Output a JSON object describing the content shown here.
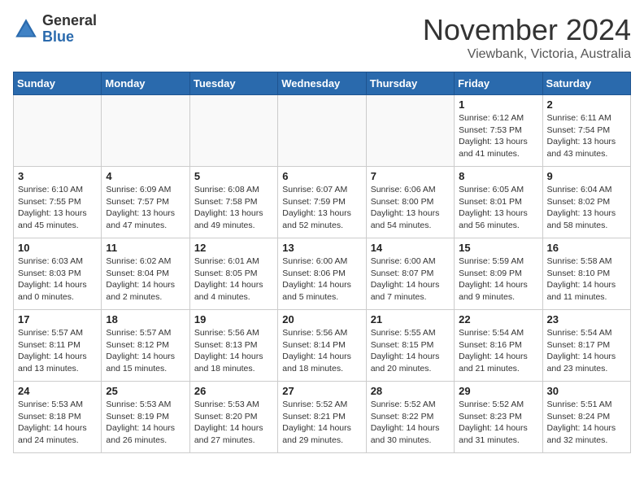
{
  "header": {
    "logo_general": "General",
    "logo_blue": "Blue",
    "month_year": "November 2024",
    "location": "Viewbank, Victoria, Australia"
  },
  "weekdays": [
    "Sunday",
    "Monday",
    "Tuesday",
    "Wednesday",
    "Thursday",
    "Friday",
    "Saturday"
  ],
  "weeks": [
    [
      {
        "day": "",
        "text": ""
      },
      {
        "day": "",
        "text": ""
      },
      {
        "day": "",
        "text": ""
      },
      {
        "day": "",
        "text": ""
      },
      {
        "day": "",
        "text": ""
      },
      {
        "day": "1",
        "text": "Sunrise: 6:12 AM\nSunset: 7:53 PM\nDaylight: 13 hours\nand 41 minutes."
      },
      {
        "day": "2",
        "text": "Sunrise: 6:11 AM\nSunset: 7:54 PM\nDaylight: 13 hours\nand 43 minutes."
      }
    ],
    [
      {
        "day": "3",
        "text": "Sunrise: 6:10 AM\nSunset: 7:55 PM\nDaylight: 13 hours\nand 45 minutes."
      },
      {
        "day": "4",
        "text": "Sunrise: 6:09 AM\nSunset: 7:57 PM\nDaylight: 13 hours\nand 47 minutes."
      },
      {
        "day": "5",
        "text": "Sunrise: 6:08 AM\nSunset: 7:58 PM\nDaylight: 13 hours\nand 49 minutes."
      },
      {
        "day": "6",
        "text": "Sunrise: 6:07 AM\nSunset: 7:59 PM\nDaylight: 13 hours\nand 52 minutes."
      },
      {
        "day": "7",
        "text": "Sunrise: 6:06 AM\nSunset: 8:00 PM\nDaylight: 13 hours\nand 54 minutes."
      },
      {
        "day": "8",
        "text": "Sunrise: 6:05 AM\nSunset: 8:01 PM\nDaylight: 13 hours\nand 56 minutes."
      },
      {
        "day": "9",
        "text": "Sunrise: 6:04 AM\nSunset: 8:02 PM\nDaylight: 13 hours\nand 58 minutes."
      }
    ],
    [
      {
        "day": "10",
        "text": "Sunrise: 6:03 AM\nSunset: 8:03 PM\nDaylight: 14 hours\nand 0 minutes."
      },
      {
        "day": "11",
        "text": "Sunrise: 6:02 AM\nSunset: 8:04 PM\nDaylight: 14 hours\nand 2 minutes."
      },
      {
        "day": "12",
        "text": "Sunrise: 6:01 AM\nSunset: 8:05 PM\nDaylight: 14 hours\nand 4 minutes."
      },
      {
        "day": "13",
        "text": "Sunrise: 6:00 AM\nSunset: 8:06 PM\nDaylight: 14 hours\nand 5 minutes."
      },
      {
        "day": "14",
        "text": "Sunrise: 6:00 AM\nSunset: 8:07 PM\nDaylight: 14 hours\nand 7 minutes."
      },
      {
        "day": "15",
        "text": "Sunrise: 5:59 AM\nSunset: 8:09 PM\nDaylight: 14 hours\nand 9 minutes."
      },
      {
        "day": "16",
        "text": "Sunrise: 5:58 AM\nSunset: 8:10 PM\nDaylight: 14 hours\nand 11 minutes."
      }
    ],
    [
      {
        "day": "17",
        "text": "Sunrise: 5:57 AM\nSunset: 8:11 PM\nDaylight: 14 hours\nand 13 minutes."
      },
      {
        "day": "18",
        "text": "Sunrise: 5:57 AM\nSunset: 8:12 PM\nDaylight: 14 hours\nand 15 minutes."
      },
      {
        "day": "19",
        "text": "Sunrise: 5:56 AM\nSunset: 8:13 PM\nDaylight: 14 hours\nand 18 minutes."
      },
      {
        "day": "20",
        "text": "Sunrise: 5:56 AM\nSunset: 8:14 PM\nDaylight: 14 hours\nand 18 minutes."
      },
      {
        "day": "21",
        "text": "Sunrise: 5:55 AM\nSunset: 8:15 PM\nDaylight: 14 hours\nand 20 minutes."
      },
      {
        "day": "22",
        "text": "Sunrise: 5:54 AM\nSunset: 8:16 PM\nDaylight: 14 hours\nand 21 minutes."
      },
      {
        "day": "23",
        "text": "Sunrise: 5:54 AM\nSunset: 8:17 PM\nDaylight: 14 hours\nand 23 minutes."
      }
    ],
    [
      {
        "day": "24",
        "text": "Sunrise: 5:53 AM\nSunset: 8:18 PM\nDaylight: 14 hours\nand 24 minutes."
      },
      {
        "day": "25",
        "text": "Sunrise: 5:53 AM\nSunset: 8:19 PM\nDaylight: 14 hours\nand 26 minutes."
      },
      {
        "day": "26",
        "text": "Sunrise: 5:53 AM\nSunset: 8:20 PM\nDaylight: 14 hours\nand 27 minutes."
      },
      {
        "day": "27",
        "text": "Sunrise: 5:52 AM\nSunset: 8:21 PM\nDaylight: 14 hours\nand 29 minutes."
      },
      {
        "day": "28",
        "text": "Sunrise: 5:52 AM\nSunset: 8:22 PM\nDaylight: 14 hours\nand 30 minutes."
      },
      {
        "day": "29",
        "text": "Sunrise: 5:52 AM\nSunset: 8:23 PM\nDaylight: 14 hours\nand 31 minutes."
      },
      {
        "day": "30",
        "text": "Sunrise: 5:51 AM\nSunset: 8:24 PM\nDaylight: 14 hours\nand 32 minutes."
      }
    ]
  ]
}
